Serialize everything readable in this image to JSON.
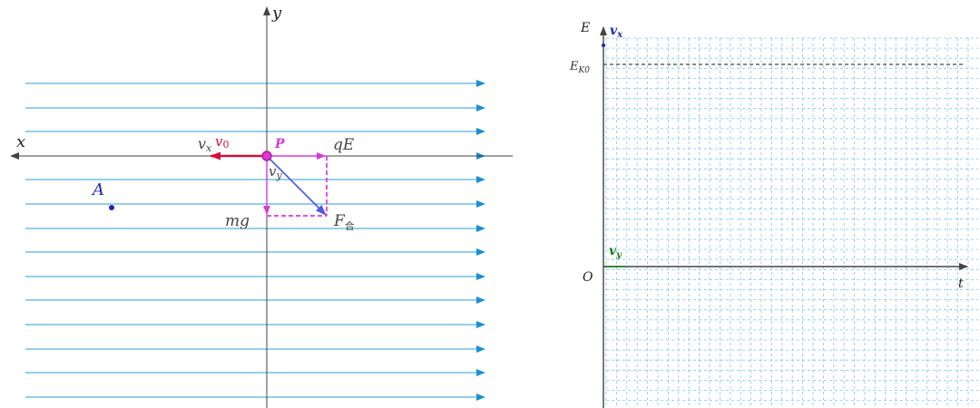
{
  "left_diagram": {
    "axis_x": "x",
    "axis_y": "y",
    "point_P": "P",
    "point_A": "A",
    "label_vx": "v",
    "label_vx_sub": "x",
    "label_v0": "v",
    "label_v0_sub": "0",
    "label_vy": "v",
    "label_vy_sub": "y",
    "label_qE": "qE",
    "label_mg": "mg",
    "label_F": "F",
    "label_F_sub": "合",
    "field_line_count": 14
  },
  "right_graph": {
    "axis_E": "E",
    "axis_t": "t",
    "origin": "O",
    "label_EK0": "E",
    "label_EK0_sub": "K0",
    "legend_vx": "v",
    "legend_vx_sub": "x",
    "legend_vy": "v",
    "legend_vy_sub": "y"
  },
  "colors": {
    "field_line": "#2a9fd8",
    "axis": "#444444",
    "force": "#d63ad6",
    "velocity": "#d0103a",
    "resultant": "#4a5ae8",
    "point_A": "#1a2ab0",
    "grid": "#7fc8e8",
    "vy_green": "#1a7a1a",
    "vx_blue": "#1a2ab0"
  }
}
